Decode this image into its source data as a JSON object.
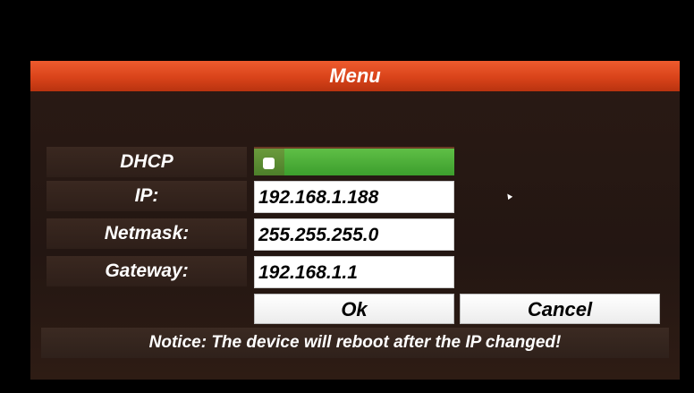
{
  "dialog": {
    "title": "Menu"
  },
  "fields": {
    "dhcp": {
      "label": "DHCP",
      "enabled": true
    },
    "ip": {
      "label": "IP:",
      "value": "192.168.1.188"
    },
    "netmask": {
      "label": "Netmask:",
      "value": "255.255.255.0"
    },
    "gateway": {
      "label": "Gateway:",
      "value": "192.168.1.1"
    }
  },
  "buttons": {
    "ok_label": "Ok",
    "cancel_label": "Cancel"
  },
  "notice": "Notice: The device will reboot after the IP changed!",
  "colors": {
    "title_bar": "#d9431a",
    "toggle_on": "#3c9e2d",
    "dialog_bg": "#2a1a14"
  },
  "icons": {
    "cursor": "mouse-pointer-icon"
  }
}
